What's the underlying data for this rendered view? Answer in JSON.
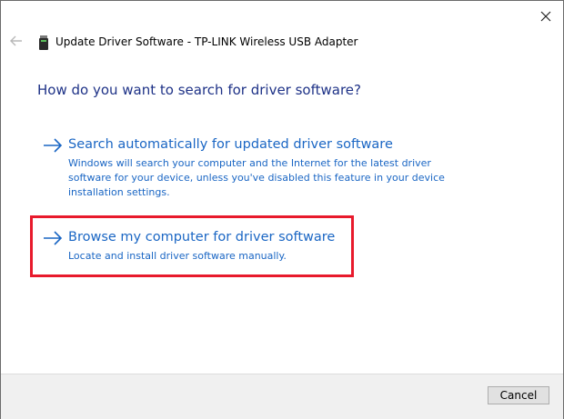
{
  "window": {
    "title": "Update Driver Software - TP-LINK Wireless USB Adapter",
    "close_icon": "close-icon",
    "back_icon": "back-arrow-icon"
  },
  "main": {
    "heading": "How do you want to search for driver software?",
    "options": [
      {
        "title": "Search automatically for updated driver software",
        "description": "Windows will search your computer and the Internet for the latest driver software for your device, unless you've disabled this feature in your device installation settings."
      },
      {
        "title": "Browse my computer for driver software",
        "description": "Locate and install driver software manually."
      }
    ]
  },
  "footer": {
    "cancel_label": "Cancel"
  },
  "colors": {
    "link": "#1a66c4",
    "heading": "#1e3287",
    "highlight": "#e81a2c"
  }
}
